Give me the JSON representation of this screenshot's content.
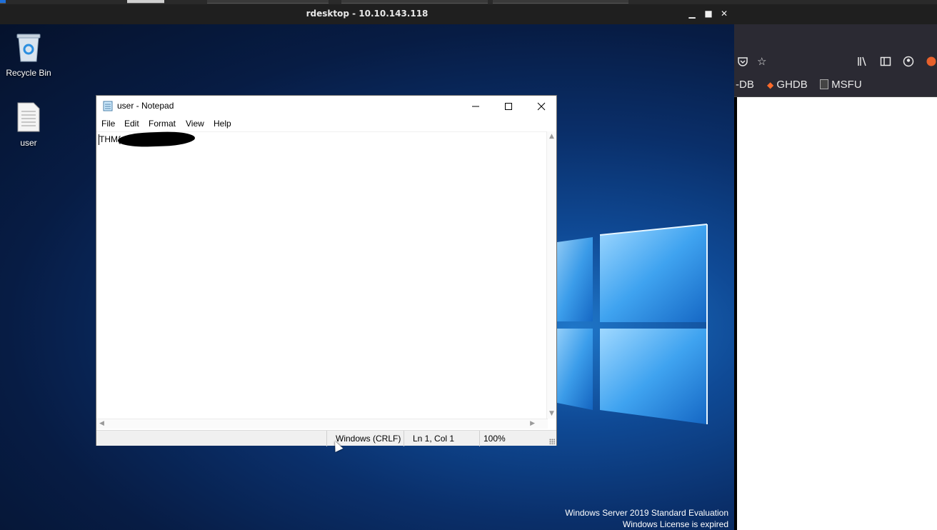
{
  "rdesktop": {
    "title": "rdesktop - 10.10.143.118",
    "minimize_glyph": "▁",
    "maximize_glyph": "■",
    "close_glyph": "✕"
  },
  "desktop": {
    "icons": [
      {
        "label": "Recycle Bin",
        "icon": "recycle-bin-icon"
      },
      {
        "label": "user",
        "icon": "text-file-icon"
      }
    ],
    "watermark_line1": "Windows Server 2019 Standard Evaluation",
    "watermark_line2": "Windows License is expired"
  },
  "notepad": {
    "title": "user - Notepad",
    "menu": [
      "File",
      "Edit",
      "Format",
      "View",
      "Help"
    ],
    "content_visible": "THM{",
    "content_redacted": true,
    "status": {
      "line_ending": "Windows (CRLF)",
      "position": "Ln 1, Col 1",
      "zoom": "100%"
    }
  },
  "host_browser": {
    "bookmarks": [
      "-DB",
      "GHDB",
      "MSFU"
    ]
  },
  "colors": {
    "desktop_accent": "#1f76c8",
    "titlebar": "#1f1f1f",
    "browser_toolbar": "#2b2a33"
  }
}
